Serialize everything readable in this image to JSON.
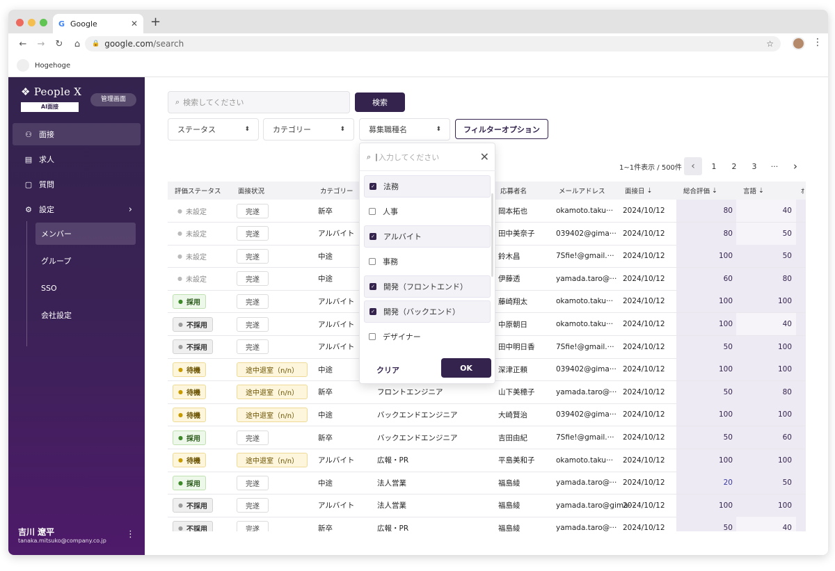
{
  "browser": {
    "tab_title": "Google",
    "url_host": "google.com",
    "url_path": "/search",
    "bookmark": "Hogehoge"
  },
  "sidebar": {
    "logo": "People X",
    "ai_label": "AI面接",
    "admin_label": "管理画面",
    "items": [
      {
        "label": "面接",
        "icon": "people-icon"
      },
      {
        "label": "求人",
        "icon": "building-icon"
      },
      {
        "label": "質問",
        "icon": "clipboard-icon"
      },
      {
        "label": "設定",
        "icon": "gear-icon"
      }
    ],
    "sub_items": [
      "メンバー",
      "グループ",
      "SSO",
      "会社設定"
    ],
    "user": {
      "name": "吉川 遼平",
      "email": "tanaka.mitsuko@company.co.jp"
    }
  },
  "search": {
    "placeholder": "検索してください",
    "button": "検索"
  },
  "filters": {
    "status": "ステータス",
    "category": "カテゴリー",
    "job": "募集職種名",
    "options_button": "フィルターオプション"
  },
  "pagination": {
    "info": "1~1件表示 / 500件",
    "pages": [
      "1",
      "2",
      "3",
      "···"
    ]
  },
  "table": {
    "headers": [
      "評価ステータス",
      "面接状況",
      "カテゴリー",
      "応募者名",
      "メールアドレス",
      "面接日",
      "総合評価",
      "言語",
      "ｵ"
    ],
    "rows": [
      {
        "status": "未設定",
        "progress": "完遂",
        "category": "新卒",
        "job": "",
        "name": "岡本拓也",
        "email": "okamoto.taku···",
        "date": "2024/10/12",
        "total": "80",
        "lang": "40"
      },
      {
        "status": "未設定",
        "progress": "完遂",
        "category": "アルバイト",
        "job": "",
        "name": "田中美奈子",
        "email": "039402@gima···",
        "date": "2024/10/12",
        "total": "80",
        "lang": "50"
      },
      {
        "status": "未設定",
        "progress": "完遂",
        "category": "中途",
        "job": "",
        "name": "鈴木昌",
        "email": "7Sfie!@gmail.···",
        "date": "2024/10/12",
        "total": "100",
        "lang": "50"
      },
      {
        "status": "未設定",
        "progress": "完遂",
        "category": "中途",
        "job": "",
        "name": "伊藤透",
        "email": "yamada.taro@···",
        "date": "2024/10/12",
        "total": "60",
        "lang": "80"
      },
      {
        "status": "採用",
        "progress": "完遂",
        "category": "アルバイト",
        "job": "",
        "name": "藤崎翔太",
        "email": "okamoto.taku···",
        "date": "2024/10/12",
        "total": "100",
        "lang": "100"
      },
      {
        "status": "不採用",
        "progress": "完遂",
        "category": "アルバイト",
        "job": "",
        "name": "中原朝日",
        "email": "okamoto.taku···",
        "date": "2024/10/12",
        "total": "100",
        "lang": "40"
      },
      {
        "status": "不採用",
        "progress": "完遂",
        "category": "アルバイト",
        "job": "",
        "name": "田中明日香",
        "email": "7Sfie!@gmail.···",
        "date": "2024/10/12",
        "total": "50",
        "lang": "100"
      },
      {
        "status": "待機",
        "progress": "途中退室（n/n）",
        "category": "中途",
        "job": "",
        "name": "深津正頼",
        "email": "039402@gima···",
        "date": "2024/10/12",
        "total": "100",
        "lang": "100"
      },
      {
        "status": "待機",
        "progress": "途中退室（n/n）",
        "category": "新卒",
        "job": "フロントエンジニア",
        "name": "山下美穂子",
        "email": "yamada.taro@···",
        "date": "2024/10/12",
        "total": "50",
        "lang": "80"
      },
      {
        "status": "待機",
        "progress": "途中退室（n/n）",
        "category": "中途",
        "job": "バックエンドエンジニア",
        "name": "大崎賢治",
        "email": "039402@gima···",
        "date": "2024/10/12",
        "total": "100",
        "lang": "100"
      },
      {
        "status": "採用",
        "progress": "完遂",
        "category": "新卒",
        "job": "バックエンドエンジニア",
        "name": "吉田由紀",
        "email": "7Sfie!@gmail.···",
        "date": "2024/10/12",
        "total": "50",
        "lang": "60"
      },
      {
        "status": "待機",
        "progress": "途中退室（n/n）",
        "category": "アルバイト",
        "job": "広報・PR",
        "name": "平島美和子",
        "email": "okamoto.taku···",
        "date": "2024/10/12",
        "total": "100",
        "lang": "100"
      },
      {
        "status": "採用",
        "progress": "完遂",
        "category": "中途",
        "job": "法人営業",
        "name": "福島綾",
        "email": "yamada.taro@···",
        "date": "2024/10/12",
        "total": "20",
        "lang": "50"
      },
      {
        "status": "不採用",
        "progress": "完遂",
        "category": "アルバイト",
        "job": "法人営業",
        "name": "福島綾",
        "email": "yamada.taro@gima···",
        "date": "2024/10/12",
        "total": "100",
        "lang": "100"
      },
      {
        "status": "不採用",
        "progress": "完遂",
        "category": "新卒",
        "job": "広報・PR",
        "name": "福島綾",
        "email": "yamada.taro@···",
        "date": "2024/10/12",
        "total": "50",
        "lang": "40"
      }
    ]
  },
  "popover": {
    "placeholder": "入力してください",
    "options": [
      {
        "label": "法務",
        "checked": true
      },
      {
        "label": "人事",
        "checked": false
      },
      {
        "label": "アルバイト",
        "checked": true
      },
      {
        "label": "事務",
        "checked": false
      },
      {
        "label": "開発（フロントエンド）",
        "checked": true
      },
      {
        "label": "開発（バックエンド）",
        "checked": true
      },
      {
        "label": "デザイナー",
        "checked": false
      }
    ],
    "clear": "クリア",
    "ok": "OK"
  },
  "colors": {
    "primary": "#33234d",
    "sidebar_end": "#4e1a6a"
  }
}
